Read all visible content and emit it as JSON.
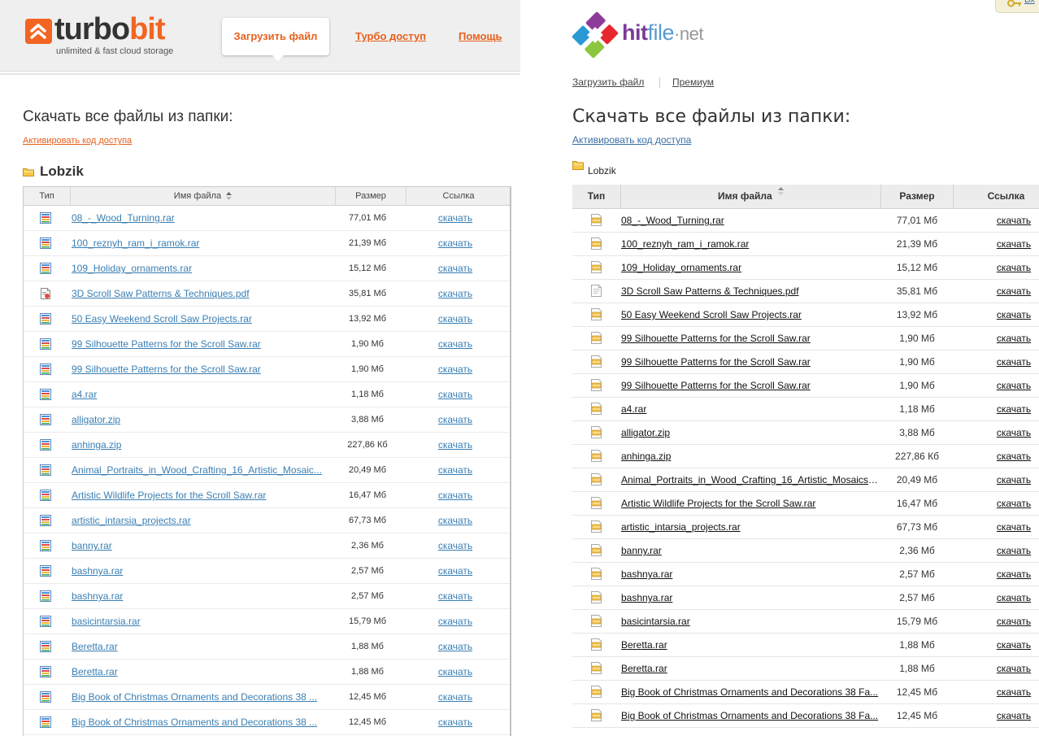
{
  "turbobit": {
    "logo": {
      "word_part1": "turbo",
      "word_part2": "bit",
      "tagline": "unlimited & fast cloud storage",
      "icon": "turbobit-logo-icon"
    },
    "nav": {
      "upload": "Загрузить файл",
      "turbo": "Турбо доступ",
      "help": "Помощь"
    },
    "title": "Скачать все файлы из папки:",
    "activate": "Активировать код доступа",
    "folder": {
      "name": "Lobzik",
      "icon": "folder-icon"
    },
    "table": {
      "headers": {
        "type": "Тип",
        "name": "Имя файла",
        "size": "Размер",
        "link": "Ссылка"
      },
      "rows": [
        {
          "name": "08_-_Wood_Turning.rar",
          "size": "77,01 Мб",
          "link": "скачать",
          "icon": "archive-icon"
        },
        {
          "name": "100_reznyh_ram_i_ramok.rar",
          "size": "21,39 Мб",
          "link": "скачать",
          "icon": "archive-icon"
        },
        {
          "name": "109_Holiday_ornaments.rar",
          "size": "15,12 Мб",
          "link": "скачать",
          "icon": "archive-icon"
        },
        {
          "name": "3D Scroll Saw Patterns & Techniques.pdf",
          "size": "35,81 Мб",
          "link": "скачать",
          "icon": "pdf-icon"
        },
        {
          "name": "50 Easy Weekend Scroll Saw Projects.rar",
          "size": "13,92 Мб",
          "link": "скачать",
          "icon": "archive-icon"
        },
        {
          "name": "99 Silhouette Patterns for the Scroll Saw.rar",
          "size": "1,90 Мб",
          "link": "скачать",
          "icon": "archive-icon"
        },
        {
          "name": "99 Silhouette Patterns for the Scroll Saw.rar",
          "size": "1,90 Мб",
          "link": "скачать",
          "icon": "archive-icon"
        },
        {
          "name": "a4.rar",
          "size": "1,18 Мб",
          "link": "скачать",
          "icon": "archive-icon"
        },
        {
          "name": "alligator.zip",
          "size": "3,88 Мб",
          "link": "скачать",
          "icon": "archive-icon"
        },
        {
          "name": "anhinga.zip",
          "size": "227,86 Кб",
          "link": "скачать",
          "icon": "archive-icon"
        },
        {
          "name": "Animal_Portraits_in_Wood_Crafting_16_Artistic_Mosaic...",
          "size": "20,49 Мб",
          "link": "скачать",
          "icon": "archive-icon"
        },
        {
          "name": "Artistic Wildlife Projects for the Scroll Saw.rar",
          "size": "16,47 Мб",
          "link": "скачать",
          "icon": "archive-icon"
        },
        {
          "name": "artistic_intarsia_projects.rar",
          "size": "67,73 Мб",
          "link": "скачать",
          "icon": "archive-icon"
        },
        {
          "name": "banny.rar",
          "size": "2,36 Мб",
          "link": "скачать",
          "icon": "archive-icon"
        },
        {
          "name": "bashnya.rar",
          "size": "2,57 Мб",
          "link": "скачать",
          "icon": "archive-icon"
        },
        {
          "name": "bashnya.rar",
          "size": "2,57 Мб",
          "link": "скачать",
          "icon": "archive-icon"
        },
        {
          "name": "basicintarsia.rar",
          "size": "15,79 Мб",
          "link": "скачать",
          "icon": "archive-icon"
        },
        {
          "name": "Beretta.rar",
          "size": "1,88 Мб",
          "link": "скачать",
          "icon": "archive-icon"
        },
        {
          "name": "Beretta.rar",
          "size": "1,88 Мб",
          "link": "скачать",
          "icon": "archive-icon"
        },
        {
          "name": "Big Book of Christmas Ornaments and Decorations 38 ...",
          "size": "12,45 Мб",
          "link": "скачать",
          "icon": "archive-icon"
        },
        {
          "name": "Big Book of Christmas Ornaments and Decorations 38 ...",
          "size": "12,45 Мб",
          "link": "скачать",
          "icon": "archive-icon"
        }
      ]
    }
  },
  "hitfile": {
    "top_button": {
      "text": "Вх",
      "icon": "key-icon"
    },
    "logo": {
      "word_part1": "hit",
      "word_part2": "file",
      "word_part3": "·net",
      "icon": "hitfile-logo-icon"
    },
    "nav": {
      "upload": "Загрузить файл",
      "premium": "Премиум"
    },
    "title": "Скачать все файлы из папки:",
    "activate": "Активировать код доступа",
    "folder": {
      "name": "Lobzik",
      "icon": "folder-icon"
    },
    "table": {
      "headers": {
        "type": "Тип",
        "name": "Имя файла",
        "size": "Размер",
        "link": "Ссылка"
      },
      "rows": [
        {
          "name": "08_-_Wood_Turning.rar",
          "size": "77,01 Мб",
          "link": "скачать",
          "icon": "archive-icon"
        },
        {
          "name": "100_reznyh_ram_i_ramok.rar",
          "size": "21,39 Мб",
          "link": "скачать",
          "icon": "archive-icon"
        },
        {
          "name": "109_Holiday_ornaments.rar",
          "size": "15,12 Мб",
          "link": "скачать",
          "icon": "archive-icon"
        },
        {
          "name": "3D Scroll Saw Patterns & Techniques.pdf",
          "size": "35,81 Мб",
          "link": "скачать",
          "icon": "document-icon"
        },
        {
          "name": "50 Easy Weekend Scroll Saw Projects.rar",
          "size": "13,92 Мб",
          "link": "скачать",
          "icon": "archive-icon"
        },
        {
          "name": "99 Silhouette Patterns for the Scroll Saw.rar",
          "size": "1,90 Мб",
          "link": "скачать",
          "icon": "archive-icon"
        },
        {
          "name": "99 Silhouette Patterns for the Scroll Saw.rar",
          "size": "1,90 Мб",
          "link": "скачать",
          "icon": "archive-icon"
        },
        {
          "name": "99 Silhouette Patterns for the Scroll Saw.rar",
          "size": "1,90 Мб",
          "link": "скачать",
          "icon": "archive-icon"
        },
        {
          "name": "a4.rar",
          "size": "1,18 Мб",
          "link": "скачать",
          "icon": "archive-icon"
        },
        {
          "name": "alligator.zip",
          "size": "3,88 Мб",
          "link": "скачать",
          "icon": "archive-icon"
        },
        {
          "name": "anhinga.zip",
          "size": "227,86 Кб",
          "link": "скачать",
          "icon": "archive-icon"
        },
        {
          "name": "Animal_Portraits_in_Wood_Crafting_16_Artistic_Mosaics_...",
          "size": "20,49 Мб",
          "link": "скачать",
          "icon": "archive-icon"
        },
        {
          "name": "Artistic Wildlife Projects for the Scroll Saw.rar",
          "size": "16,47 Мб",
          "link": "скачать",
          "icon": "archive-icon"
        },
        {
          "name": "artistic_intarsia_projects.rar",
          "size": "67,73 Мб",
          "link": "скачать",
          "icon": "archive-icon"
        },
        {
          "name": "banny.rar",
          "size": "2,36 Мб",
          "link": "скачать",
          "icon": "archive-icon"
        },
        {
          "name": "bashnya.rar",
          "size": "2,57 Мб",
          "link": "скачать",
          "icon": "archive-icon"
        },
        {
          "name": "bashnya.rar",
          "size": "2,57 Мб",
          "link": "скачать",
          "icon": "archive-icon"
        },
        {
          "name": "basicintarsia.rar",
          "size": "15,79 Мб",
          "link": "скачать",
          "icon": "archive-icon"
        },
        {
          "name": "Beretta.rar",
          "size": "1,88 Мб",
          "link": "скачать",
          "icon": "archive-icon"
        },
        {
          "name": "Beretta.rar",
          "size": "1,88 Мб",
          "link": "скачать",
          "icon": "archive-icon"
        },
        {
          "name": "Big Book of Christmas Ornaments and Decorations 38 Fa...",
          "size": "12,45 Мб",
          "link": "скачать",
          "icon": "archive-icon"
        },
        {
          "name": "Big Book of Christmas Ornaments and Decorations 38 Fa...",
          "size": "12,45 Мб",
          "link": "скачать",
          "icon": "archive-icon"
        }
      ]
    }
  },
  "colors": {
    "turbobit_accent": "#f26522",
    "turbobit_link": "#3a7fb3",
    "hitfile_link": "#3a6ea5"
  }
}
